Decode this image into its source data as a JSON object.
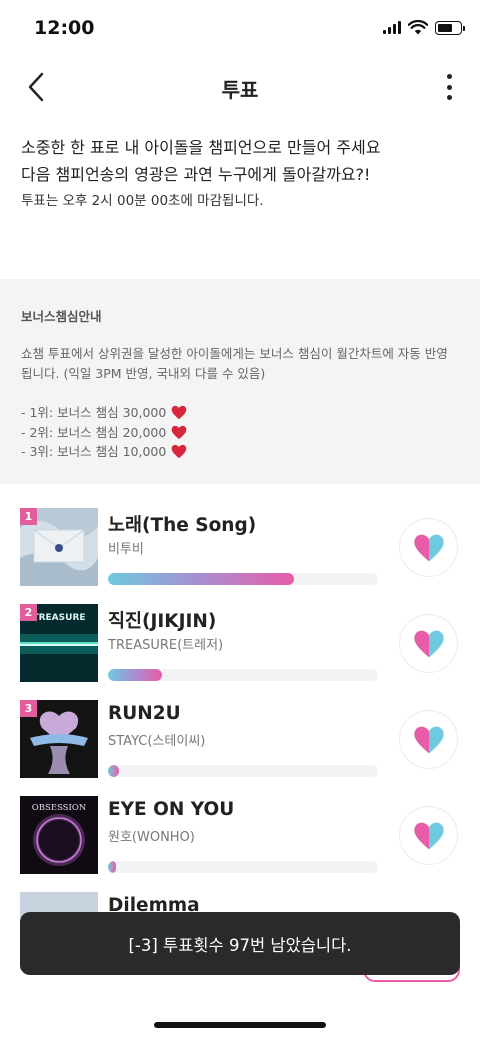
{
  "status_bar": {
    "time": "12:00"
  },
  "header": {
    "title": "투표"
  },
  "intro": {
    "line1": "소중한 한 표로 내 아이돌을 챔피언으로 만들어 주세요",
    "line2": "다음 챔피언송의 영광은 과연 누구에게 돌아갈까요?!",
    "deadline": "투표는 오후 2시 00분 00초에 마감됩니다."
  },
  "bonus": {
    "title": "보너스챔심안내",
    "description": "쇼챔 투표에서 상위권을 달성한 아이돌에게는 보너스 챔심이 월간차트에 자동 반영됩니다. (익일 3PM 반영, 국내외 다를 수 있음)",
    "items": [
      {
        "label": "- 1위: 보너스 챔심 30,000"
      },
      {
        "label": "- 2위: 보너스 챔심 20,000"
      },
      {
        "label": "- 3위: 보너스 챔심 10,000"
      }
    ],
    "heart_color": "#d7263d"
  },
  "chart": {
    "entries": [
      {
        "rank": "1",
        "title": "노래(The Song)",
        "artist": "비투비",
        "vote_share": 0.69
      },
      {
        "rank": "2",
        "title": "직진(JIKJIN)",
        "artist": "TREASURE(트레저)",
        "vote_share": 0.2
      },
      {
        "rank": "3",
        "title": "RUN2U",
        "artist": "STAYC(스테이씨)",
        "vote_share": 0.04
      },
      {
        "rank": "",
        "title": "EYE ON YOU",
        "artist": "원호(WONHO)",
        "vote_share": 0.03
      },
      {
        "rank": "",
        "title": "Dilemma",
        "artist": "",
        "vote_share": 0
      }
    ],
    "album_art_texts": {
      "album2": "TREASURE",
      "album4": "OBSESSION"
    },
    "accent_color": "#e75da8",
    "heart_left_color": "#e75da8",
    "heart_right_color": "#6fc9e0"
  },
  "toast": {
    "message": "[-3] 투표횟수 97번 남았습니다."
  },
  "icons": {
    "back": "chevron-left-icon",
    "more": "more-vertical-icon",
    "vote": "heart-icon",
    "bonus": "red-heart-icon"
  }
}
